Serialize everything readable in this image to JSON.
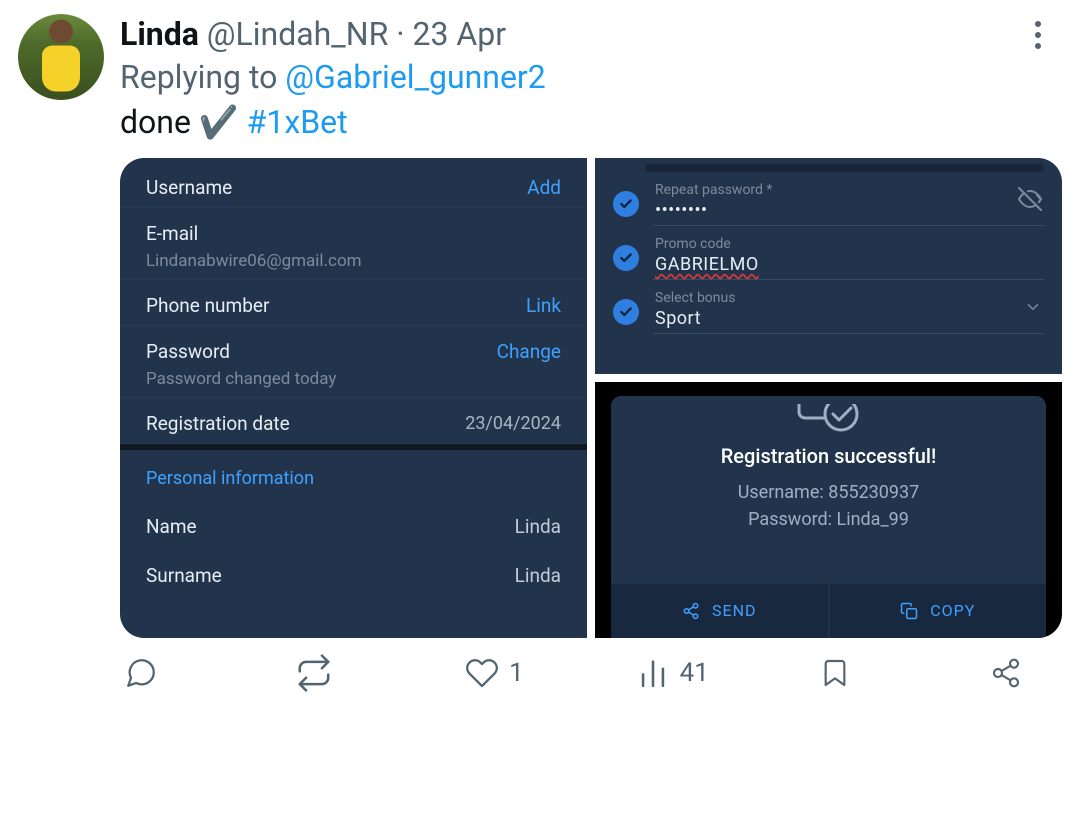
{
  "tweet": {
    "display_name": "Linda",
    "handle": "@Lindah_NR",
    "dot": "·",
    "date": "23 Apr",
    "replying_prefix": "Replying to ",
    "replying_handle": "@Gabriel_gunner2",
    "content_text": "done ",
    "content_emoji": "✔️",
    "hashtag": "#1xBet",
    "more_label": "More"
  },
  "left_card": {
    "username_label": "Username",
    "username_action": "Add",
    "email_label": "E-mail",
    "email_value": "Lindanabwire06@gmail.com",
    "phone_label": "Phone number",
    "phone_action": "Link",
    "password_label": "Password",
    "password_sub": "Password changed today",
    "password_action": "Change",
    "regdate_label": "Registration date",
    "regdate_value": "23/04/2024",
    "section_title": "Personal information",
    "name_label": "Name",
    "name_value": "Linda",
    "surname_label": "Surname",
    "surname_value": "Linda"
  },
  "form_card": {
    "repeat_label": "Repeat password *",
    "repeat_value": "••••••••",
    "promo_label": "Promo code",
    "promo_value": "GABRIELMO",
    "bonus_label": "Select bonus",
    "bonus_value": "Sport"
  },
  "success": {
    "title": "Registration successful!",
    "username_label": "Username:",
    "username_value": "855230937",
    "password_label": "Password:",
    "password_value": "Linda_99",
    "send_label": "SEND",
    "copy_label": "COPY"
  },
  "actions": {
    "reply_count": "",
    "retweet_count": "",
    "like_count": "1",
    "view_count": "41"
  }
}
